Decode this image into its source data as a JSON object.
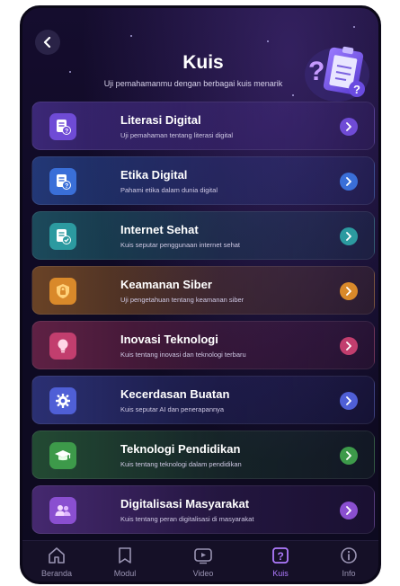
{
  "header": {
    "back_icon": "chevron-left-icon",
    "title": "Kuis",
    "subtitle": "Uji pemahamanmu dengan berbagai kuis menarik",
    "hero_icon": "clipboard-question-icon"
  },
  "quizzes": [
    {
      "title": "Literasi Digital",
      "desc": "Uji pemahaman tentang literasi digital",
      "icon": "document-question-icon",
      "color": "#6f4bd6"
    },
    {
      "title": "Etika Digital",
      "desc": "Pahami etika dalam dunia digital",
      "icon": "document-question-icon",
      "color": "#3a6fd8"
    },
    {
      "title": "Internet Sehat",
      "desc": "Kuis seputar penggunaan internet sehat",
      "icon": "document-check-icon",
      "color": "#2c9aa0"
    },
    {
      "title": "Keamanan Siber",
      "desc": "Uji pengetahuan tentang keamanan siber",
      "icon": "lock-icon",
      "color": "#d9892a"
    },
    {
      "title": "Inovasi Teknologi",
      "desc": "Kuis tentang inovasi dan teknologi terbaru",
      "icon": "lightbulb-icon",
      "color": "#c23e6e"
    },
    {
      "title": "Kecerdasan Buatan",
      "desc": "Kuis seputar AI dan penerapannya",
      "icon": "gear-icon",
      "color": "#4f5fd6"
    },
    {
      "title": "Teknologi Pendidikan",
      "desc": "Kuis tentang teknologi dalam pendidikan",
      "icon": "graduation-cap-icon",
      "color": "#3d9a4a"
    },
    {
      "title": "Digitalisasi Masyarakat",
      "desc": "Kuis tentang peran digitalisasi di masyarakat",
      "icon": "people-icon",
      "color": "#8a4fd0"
    }
  ],
  "nav": {
    "items": [
      {
        "label": "Beranda",
        "icon": "home-icon"
      },
      {
        "label": "Modul",
        "icon": "book-icon"
      },
      {
        "label": "Video",
        "icon": "video-icon"
      },
      {
        "label": "Kuis",
        "icon": "quiz-icon"
      },
      {
        "label": "Info",
        "icon": "info-icon"
      }
    ],
    "active": "Kuis"
  },
  "colors": {
    "background": "#0f0a24",
    "accent": "#b07bff",
    "nav_inactive": "#9a94b3"
  }
}
